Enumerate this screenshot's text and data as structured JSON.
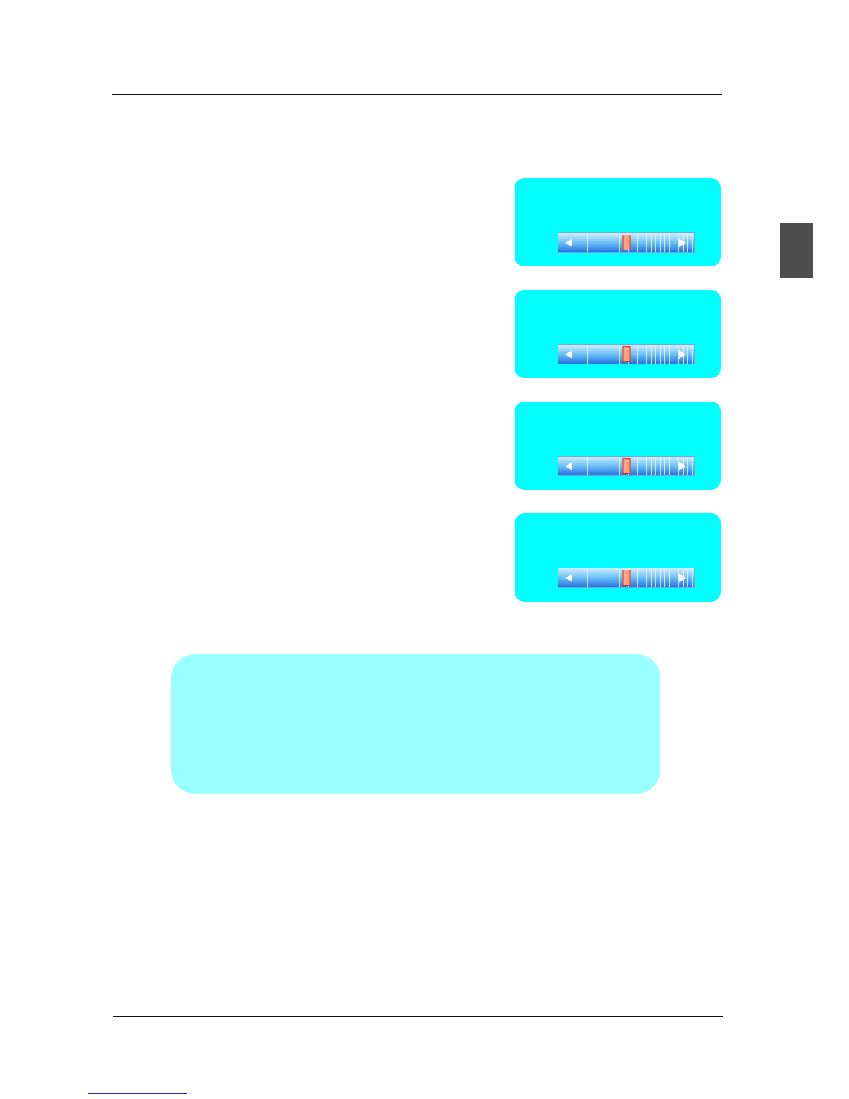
{
  "panels": [
    {
      "slider": {
        "level": 0.5
      }
    },
    {
      "slider": {
        "level": 0.5
      }
    },
    {
      "slider": {
        "level": 0.5
      }
    },
    {
      "slider": {
        "level": 0.5
      }
    }
  ]
}
